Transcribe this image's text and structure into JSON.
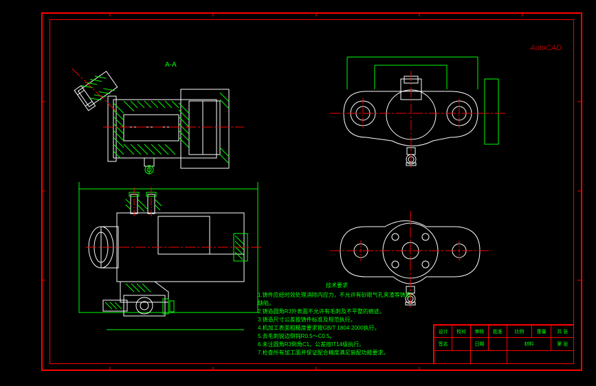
{
  "section_label": "A-A",
  "watermark_text": "AutoCAD",
  "tech_notes": {
    "title": "技术要求",
    "lines": [
      "1.铸件应经时效处理消除内应力，不允许有砂眼气孔夹渣等铸造缺陷。",
      "2.铸造圆角R3外表面不允许有毛刺及不平整的痕迹。",
      "3.铸造尺寸公差按铸件标准及规范执行。",
      "4.机加工表面粗糙度要求按GB/T 1804-2000执行。",
      "5.去毛刺锐边倒钝R0.5～C0.5。",
      "6.未注圆角R3倒角C1，公差按IT14级执行。",
      "7.检查所有加工面并保证配合精度满足装配功能要求。"
    ]
  },
  "title_block": {
    "row1": [
      "设计",
      "校对",
      "审核",
      "批准",
      "比例",
      "重量",
      "共 张"
    ],
    "row2": [
      "签名",
      "",
      "日期",
      "",
      "材料",
      "第 张"
    ],
    "row3": [
      "",
      "",
      "",
      "",
      "",
      ""
    ]
  }
}
